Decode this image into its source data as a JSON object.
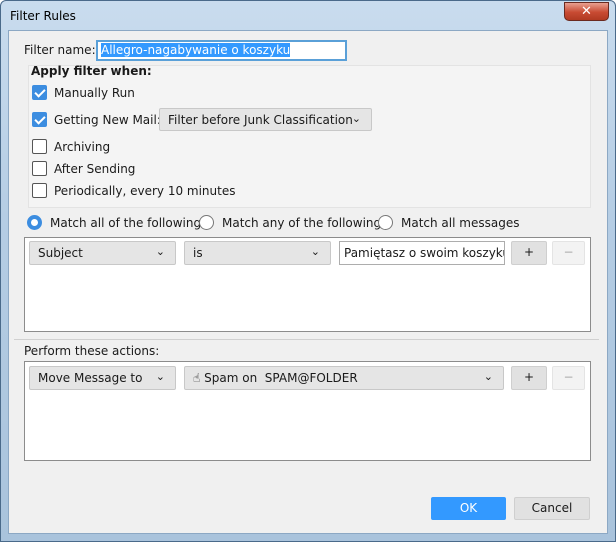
{
  "window": {
    "title": "Filter Rules",
    "close_icon": "close-icon"
  },
  "filter_name": {
    "label": "Filter name:",
    "value": "Allegro-nagabywanie o koszyku"
  },
  "apply": {
    "heading": "Apply filter when:",
    "manual": {
      "label": "Manually Run",
      "checked": true
    },
    "new_mail": {
      "label": "Getting New Mail:",
      "checked": true,
      "dropdown": "Filter before Junk Classification"
    },
    "archiving": {
      "label": "Archiving",
      "checked": false
    },
    "after_sending": {
      "label": "After Sending",
      "checked": false
    },
    "periodically": {
      "label": "Periodically, every 10 minutes",
      "checked": false
    }
  },
  "match": {
    "all": "Match all of the following",
    "any": "Match any of the following",
    "all_messages": "Match all messages",
    "selected": "all"
  },
  "rule": {
    "field": "Subject",
    "operator": "is",
    "value": "Pamiętasz o swoim koszyku? 🛒",
    "add": "+",
    "remove": "−"
  },
  "actions": {
    "label": "Perform these actions:",
    "action": "Move Message to",
    "folder": "Spam on  SPAM@FOLDER",
    "add": "+",
    "remove": "−"
  },
  "buttons": {
    "ok": "OK",
    "cancel": "Cancel"
  },
  "colors": {
    "accent": "#3c8de0",
    "ok_button": "#3399ff"
  }
}
